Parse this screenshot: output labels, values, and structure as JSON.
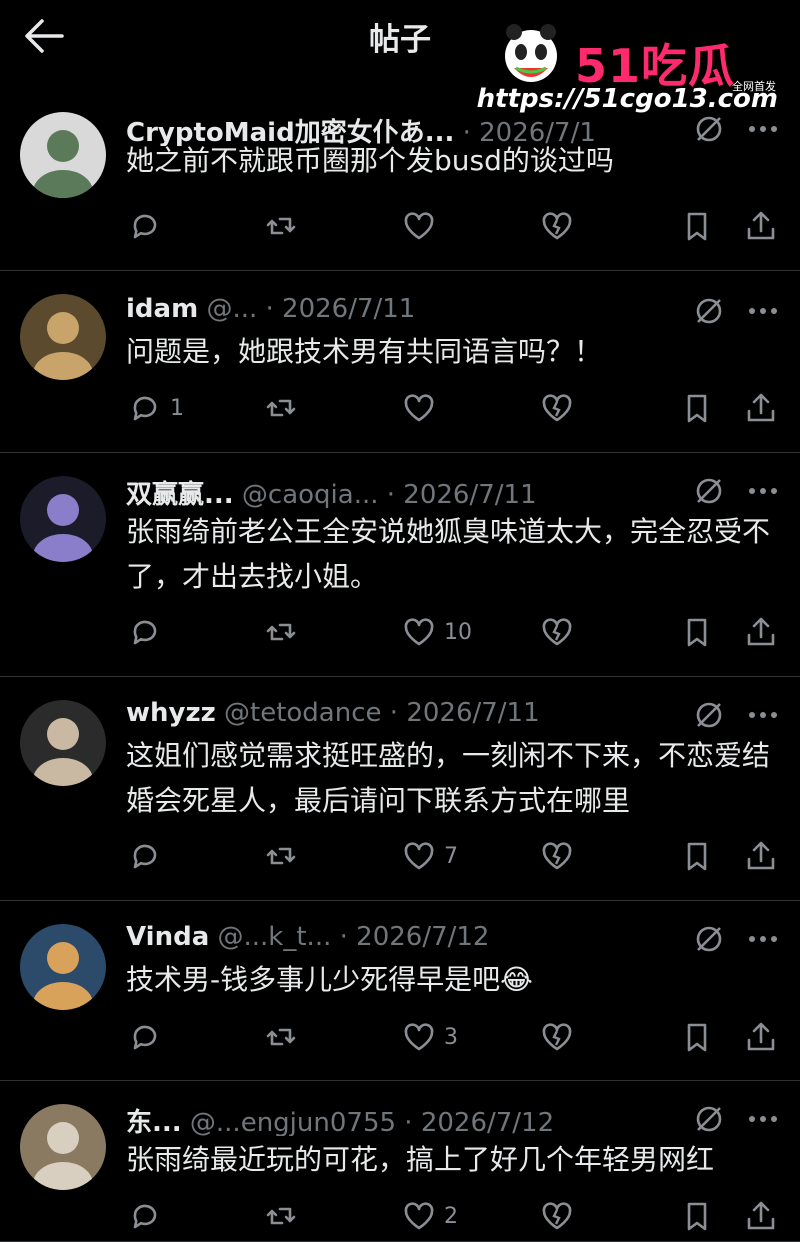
{
  "header": {
    "title": "帖子",
    "back_icon": "arrow-left-icon"
  },
  "watermark": {
    "logo": "51吃瓜",
    "tag": "全网首发",
    "url": "https://51cgo13.com"
  },
  "posts": [
    {
      "name": "CryptoMaid加密女仆あ...",
      "handle": "",
      "date": "2026/7/1",
      "text": "她之前不就跟币圈那个发busd的谈过吗",
      "reply_count": "",
      "like_count": ""
    },
    {
      "name": "idam",
      "handle": "@...",
      "date": "2026/7/11",
      "text": "问题是，她跟技术男有共同语言吗？！",
      "reply_count": "1",
      "like_count": ""
    },
    {
      "name": "双赢赢...",
      "handle": "@caoqia...",
      "date": "2026/7/11",
      "text": "张雨绮前老公王全安说她狐臭味道太大，完全忍受不了，才出去找小姐。",
      "reply_count": "",
      "like_count": "10"
    },
    {
      "name": "whyzz",
      "handle": "@tetodance",
      "date": "2026/7/11",
      "text": "这姐们感觉需求挺旺盛的，一刻闲不下来，不恋爱结婚会死星人，最后请问下联系方式在哪里",
      "reply_count": "",
      "like_count": "7"
    },
    {
      "name": "Vinda",
      "handle": "@...k_t...",
      "date": "2026/7/12",
      "text": "技术男-钱多事儿少死得早是吧😂",
      "reply_count": "",
      "like_count": "3"
    },
    {
      "name": "东...",
      "handle": "@...engjun0755",
      "date": "2026/7/12",
      "text": "张雨绮最近玩的可花，搞上了好几个年轻男网红",
      "reply_count": "",
      "like_count": "2"
    }
  ],
  "colors": {
    "background": "#000000",
    "text": "#e7e9ea",
    "muted": "#71767b",
    "divider": "#2f3336",
    "accent": "#ff2a6d"
  },
  "icons": [
    "reply-icon",
    "retweet-icon",
    "like-icon",
    "dislike-icon",
    "bookmark-icon",
    "share-icon",
    "grok-icon",
    "more-icon"
  ]
}
